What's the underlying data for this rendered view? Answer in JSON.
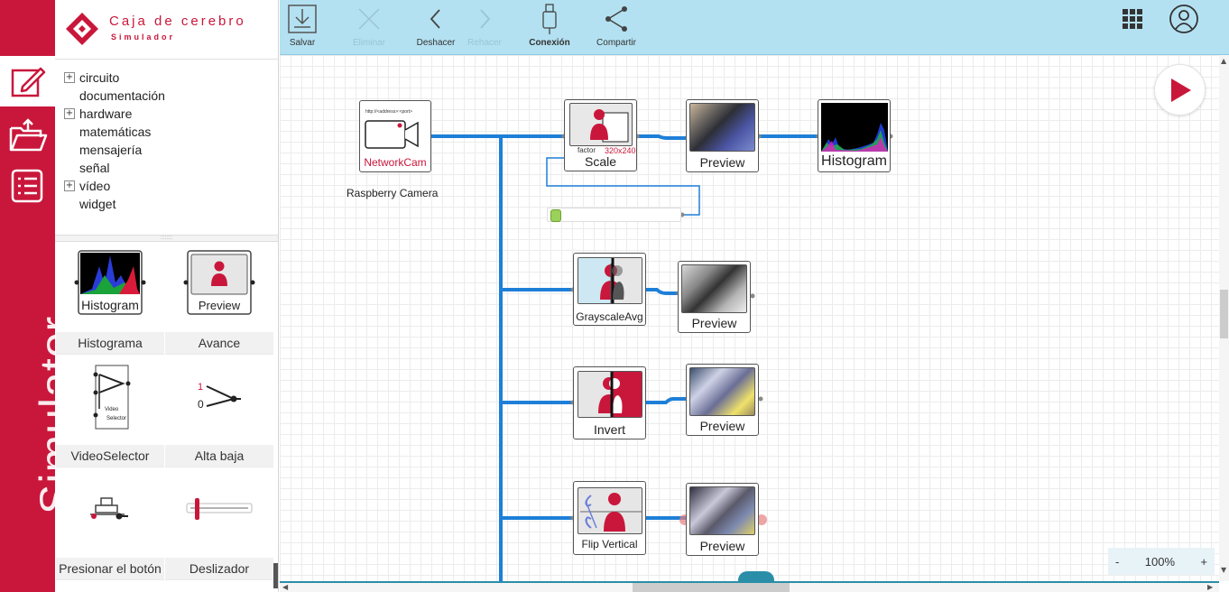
{
  "brand": {
    "name": "Caja de cerebro",
    "subtitle": "Simulador"
  },
  "rail": {
    "vertical_label": "Simulator",
    "active": "edit"
  },
  "library": {
    "tree": [
      {
        "label": "circuito",
        "expandable": true
      },
      {
        "label": "documentación",
        "expandable": false
      },
      {
        "label": "hardware",
        "expandable": true
      },
      {
        "label": "matemáticas",
        "expandable": false
      },
      {
        "label": "mensajería",
        "expandable": false
      },
      {
        "label": "señal",
        "expandable": false
      },
      {
        "label": "vídeo",
        "expandable": true
      },
      {
        "label": "widget",
        "expandable": false
      }
    ],
    "blocks": [
      {
        "label": "Histograma",
        "art_title": "Histogram"
      },
      {
        "label": "Avance",
        "art_title": "Preview"
      },
      {
        "label": "VideoSelector",
        "art_title": "Video Selector"
      },
      {
        "label": "Alta baja",
        "art_title": "1 0"
      },
      {
        "label": "Presionar el botón",
        "art_title": ""
      },
      {
        "label": "Deslizador",
        "art_title": ""
      }
    ]
  },
  "toolbar": {
    "save": "Salvar",
    "delete": "Eliminar",
    "undo": "Deshacer",
    "redo": "Rehacer",
    "connection": "Conexión",
    "share": "Compartir"
  },
  "canvas": {
    "camera": {
      "title": "NetworkCam",
      "url_hint": "http://<address>:<port>",
      "caption": "Raspberry Camera"
    },
    "scale": {
      "title": "Scale",
      "param": "factor",
      "size": "320x240"
    },
    "grayscale": {
      "title": "GrayscaleAvg"
    },
    "invert": {
      "title": "Invert"
    },
    "flip": {
      "title": "Flip Vertical"
    },
    "histogram": {
      "title": "Histogram"
    },
    "preview_title": "Preview",
    "slider": {
      "value": 0.02
    },
    "zoom": {
      "minus": "-",
      "value": "100%",
      "plus": "+"
    }
  },
  "colors": {
    "brand_red": "#c9173b",
    "wire_blue": "#1e7fd8",
    "toolbar_bg": "#b3e1f1"
  }
}
